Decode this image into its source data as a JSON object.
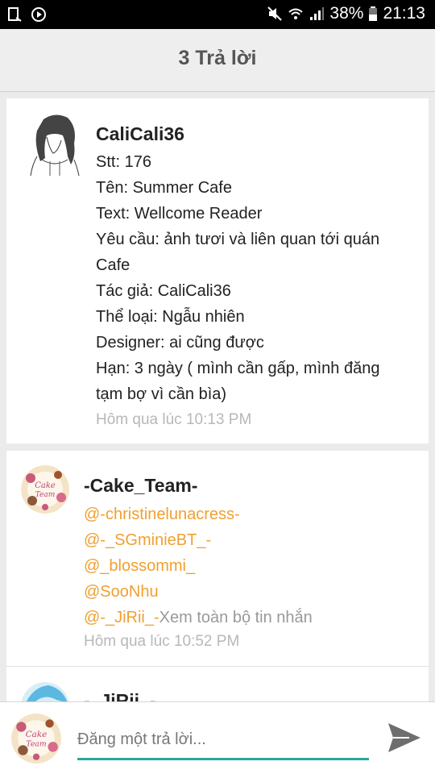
{
  "status_bar": {
    "battery": "38%",
    "time": "21:13"
  },
  "header": {
    "title": "3 Trả lời"
  },
  "posts": [
    {
      "username": "CaliCali36",
      "lines": [
        "Stt: 176",
        "Tên: Summer Cafe",
        "Text: Wellcome Reader",
        "Yêu cầu: ảnh tươi và liên quan tới quán",
        "Cafe",
        "Tác giả: CaliCali36",
        "Thể loại: Ngẫu nhiên",
        "Designer: ai cũng được",
        "Hạn: 3 ngày ( mình cần gấp, mình đăng",
        "tạm bợ vì cần bìa)"
      ],
      "time": "Hôm qua lúc 10:13 PM"
    },
    {
      "username": "-Cake_Team-",
      "avatar_text": [
        "Cake",
        "Team"
      ],
      "mentions": [
        "@-christinelunacress-",
        "@-_SGminieBT_-",
        "@_blossommi_",
        "@SooNhu",
        "@-_JiRii_-"
      ],
      "view_all": "Xem toàn bộ tin nhắn",
      "time": "Hôm qua lúc 10:52 PM"
    },
    {
      "username": "-_JiRii_-"
    }
  ],
  "reply_bar": {
    "placeholder": "Đăng một trả lời..."
  },
  "colors": {
    "mention": "#f0a030",
    "accent": "#2ba6a0",
    "timestamp": "#b8b8b8"
  }
}
